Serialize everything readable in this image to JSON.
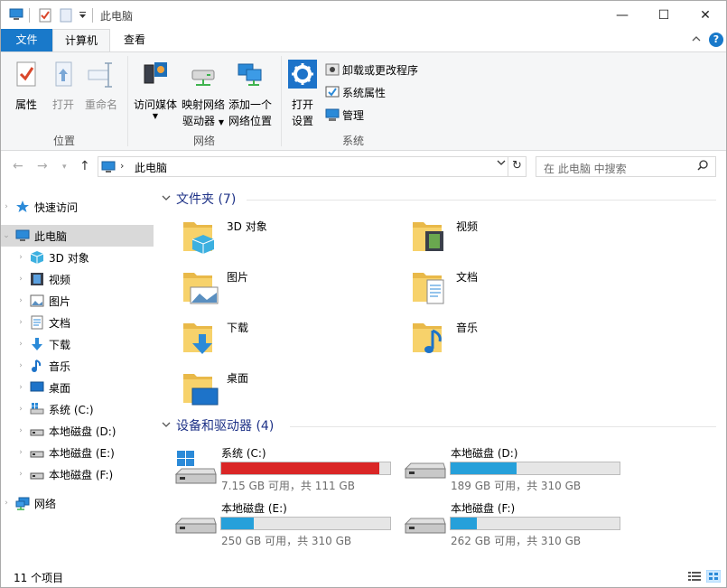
{
  "window": {
    "title": "此电脑",
    "controls": {
      "minimize": "—",
      "maximize": "☐",
      "close": "✕"
    }
  },
  "ribbon": {
    "tabs": [
      {
        "label": "文件"
      },
      {
        "label": "计算机"
      },
      {
        "label": "查看"
      }
    ],
    "groups": {
      "location": {
        "label": "位置",
        "properties": "属性",
        "open": "打开",
        "rename": "重命名"
      },
      "network": {
        "label": "网络",
        "access_media_1": "访问媒体",
        "map_drive_1": "映射网络",
        "map_drive_2": "驱动器",
        "add_location_1": "添加一个",
        "add_location_2": "网络位置"
      },
      "system": {
        "label": "系统",
        "open_settings_1": "打开",
        "open_settings_2": "设置",
        "uninstall": "卸载或更改程序",
        "system_properties": "系统属性",
        "manage": "管理"
      }
    }
  },
  "address": {
    "path": "此电脑",
    "search_placeholder": "在 此电脑 中搜索"
  },
  "nav": {
    "quick_access": "快速访问",
    "this_pc": "此电脑",
    "items": [
      {
        "label": "3D 对象"
      },
      {
        "label": "视频"
      },
      {
        "label": "图片"
      },
      {
        "label": "文档"
      },
      {
        "label": "下载"
      },
      {
        "label": "音乐"
      },
      {
        "label": "桌面"
      },
      {
        "label": "系统 (C:)"
      },
      {
        "label": "本地磁盘 (D:)"
      },
      {
        "label": "本地磁盘 (E:)"
      },
      {
        "label": "本地磁盘 (F:)"
      }
    ],
    "network": "网络"
  },
  "content": {
    "folders_header": "文件夹 (7)",
    "folders": [
      {
        "name": "3D 对象"
      },
      {
        "name": "视频"
      },
      {
        "name": "图片"
      },
      {
        "name": "文档"
      },
      {
        "name": "下载"
      },
      {
        "name": "音乐"
      },
      {
        "name": "桌面"
      }
    ],
    "drives_header": "设备和驱动器 (4)",
    "drives": [
      {
        "name": "系统 (C:)",
        "summary": "7.15 GB 可用，共 111 GB",
        "used_fraction": 0.936
      },
      {
        "name": "本地磁盘 (D:)",
        "summary": "189 GB 可用，共 310 GB",
        "used_fraction": 0.39
      },
      {
        "name": "本地磁盘 (E:)",
        "summary": "250 GB 可用，共 310 GB",
        "used_fraction": 0.194
      },
      {
        "name": "本地磁盘 (F:)",
        "summary": "262 GB 可用，共 310 GB",
        "used_fraction": 0.155
      }
    ]
  },
  "status": {
    "item_count": "11 个项目"
  },
  "colors": {
    "accent": "#1979ca",
    "drive_bar": "#26a0da",
    "drive_bar_full": "#da2626",
    "group_header": "#1e3287"
  }
}
